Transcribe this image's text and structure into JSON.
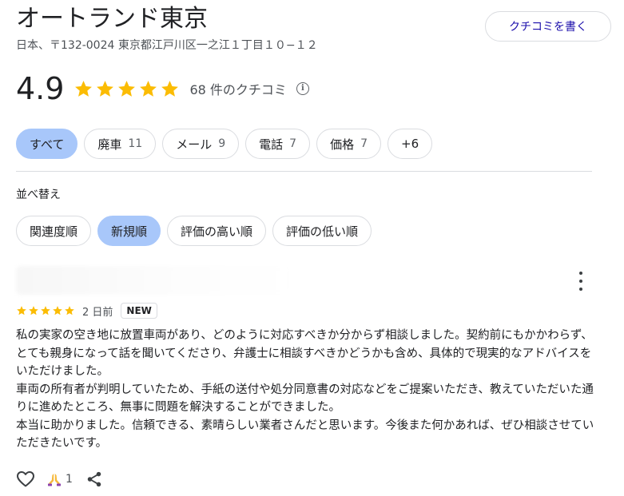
{
  "business": {
    "name": "オートランド東京",
    "address": "日本、〒132-0024 東京都江戸川区一之江１丁目１０−１２",
    "write_review_label": "クチコミを書く",
    "rating": "4.9",
    "rating_stars": 5,
    "review_count_label": "68 件のクチコミ"
  },
  "filters": [
    {
      "label": "すべて",
      "count": ""
    },
    {
      "label": "廃車",
      "count": "11"
    },
    {
      "label": "メール",
      "count": "9"
    },
    {
      "label": "電話",
      "count": "7"
    },
    {
      "label": "価格",
      "count": "7"
    },
    {
      "label": "+6",
      "count": ""
    }
  ],
  "sort": {
    "label": "並べ替え",
    "options": [
      "関連度順",
      "新規順",
      "評価の高い順",
      "評価の低い順"
    ],
    "selected": "新規順"
  },
  "review": {
    "stars": 5,
    "date": "2 日前",
    "badge": "NEW",
    "paragraphs": [
      "私の実家の空き地に放置車両があり、どのように対応すべきか分からず相談しました。契約前にもかかわらず、とても親身になって話を聞いてくださり、弁護士に相談すべきかどうかも含め、具体的で現実的なアドバイスをいただけました。",
      "車両の所有者が判明していたため、手紙の送付や処分同意書の対応などをご提案いただき、教えていただいた通りに進めたところ、無事に問題を解決することができました。",
      "本当に助かりました。信頼できる、素晴らしい業者さんだと思います。今後また何かあれば、ぜひ相談させていただきたいです。"
    ],
    "reaction_count": "1"
  },
  "icons": {
    "star": "star-icon",
    "info": "info-icon",
    "more": "more-vert-icon",
    "like": "heart-icon",
    "reaction": "praying-hands-icon",
    "share": "share-icon"
  },
  "colors": {
    "star": "#fbbc04",
    "selected_chip": "#a8c7fa",
    "link": "#1a0dab",
    "border": "#dadce0"
  }
}
